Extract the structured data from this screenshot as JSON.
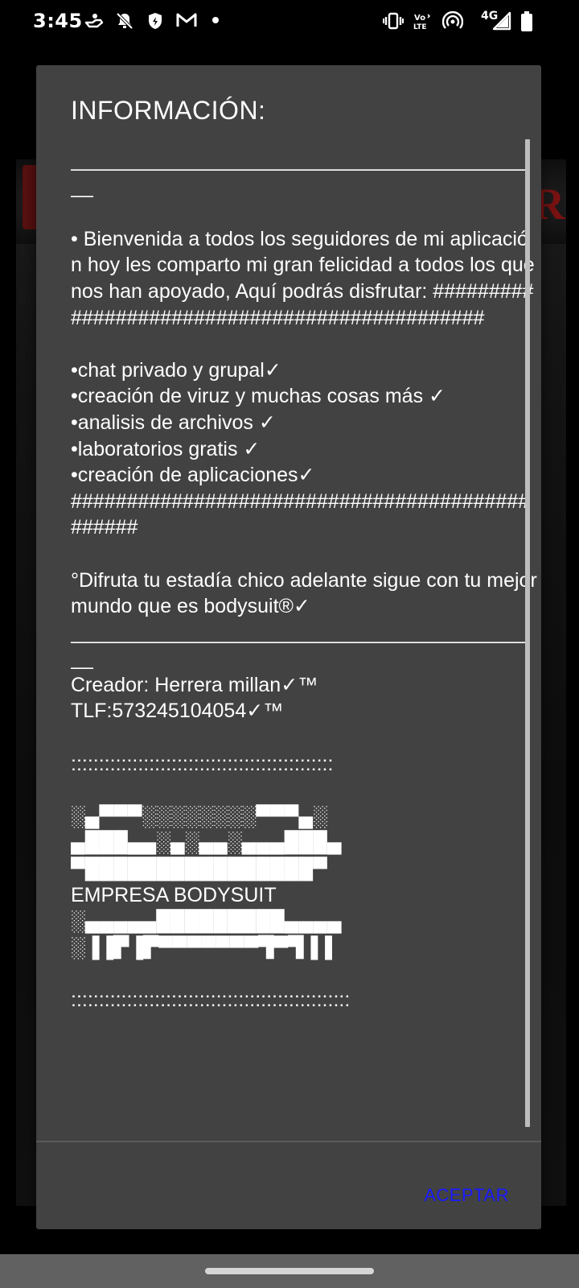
{
  "status_bar": {
    "time": "3:45",
    "network": "4G",
    "icons": [
      "hand-icon",
      "notifications-off-icon",
      "shield-icon",
      "gmail-icon",
      "dot-icon",
      "vibrate-icon",
      "volte-icon",
      "hotspot-icon",
      "signal-icon",
      "battery-icon"
    ]
  },
  "dialog": {
    "title": "INFORMACIÓN:",
    "message": "___________________________________________\n\n• Bienvenida a todos los seguidores de mi aplicación hoy les comparto mi gran felicidad a todos los que nos han apoyado, Aquí podrás disfrutar: ##############################################\n\n•chat privado y grupal✓\n•creación de viruz y muchas cosas más ✓\n•analisis de archivos ✓\n•laboratorios gratis ✓\n•creación de aplicaciones✓\n###############################################\n\n°Difruta tu estadía chico adelante sigue con tu mejor mundo que es bodysuit®✓\n___________________________________________\nCreador: Herrera millan✓™\nTLF:573245104054✓™\n\n:::::::::::::::::::::::::::::::::::::::::::::::\n\n░▄▀▀▀░░░░░░░░▀▀▀▄░\n▄███▄▄░▄░▄▄░▄▄▄███▄\n▀████████████████▀\nEMPRESA BODYSUIT\n░▄▄▄▄▄█████████▄▄▄▄\n░▐▐▛▐▛▀▀▀▀▀▀▀▜▀▜▐▐\n\n::::::::::::::::::::::::::::::::::::::::::::::::::",
    "accept_label": "ACEPTAR"
  },
  "colors": {
    "dialog_bg": "#424242",
    "accept": "#1a1aff",
    "backdrop": "#000000"
  }
}
